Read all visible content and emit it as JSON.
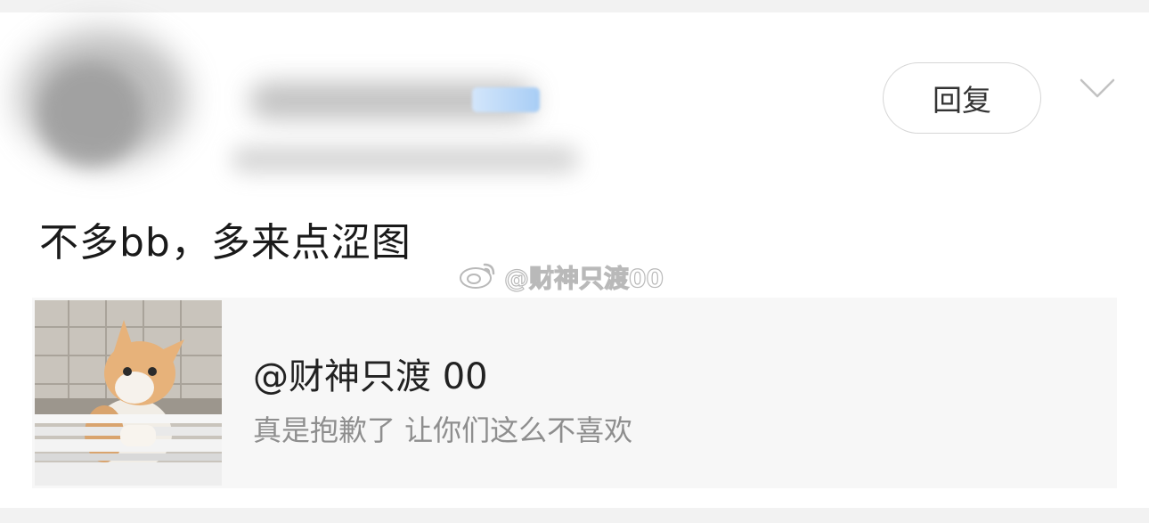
{
  "header": {
    "reply_label": "回复"
  },
  "comment": {
    "text": "不多bb，多来点涩图"
  },
  "watermark": {
    "text": "@财神只渡00"
  },
  "quote": {
    "title": "@财神只渡 00",
    "subtitle": "真是抱歉了 让你们这么不喜欢"
  },
  "icons": {
    "expand": "chevron-down-icon",
    "weibo": "weibo-logo-icon",
    "thumbnail": "cat-photo"
  }
}
